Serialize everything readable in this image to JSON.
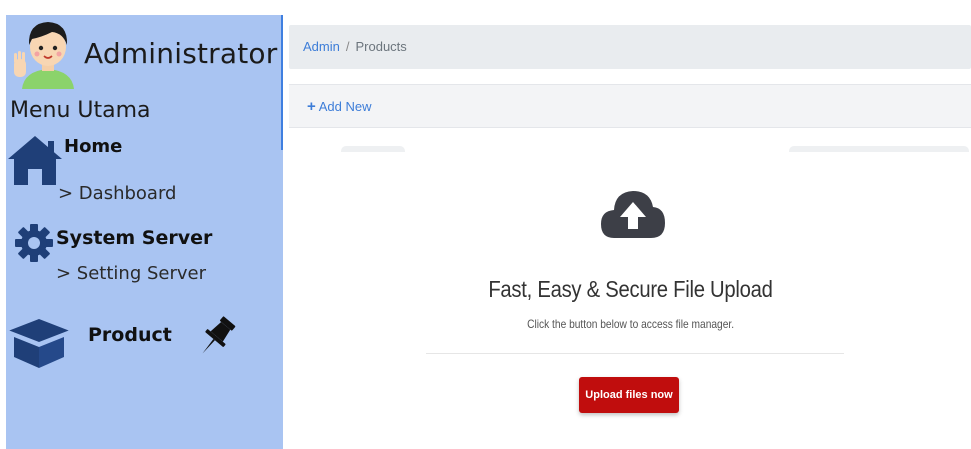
{
  "sidebar": {
    "title": "Administrator",
    "menu_heading": "Menu Utama",
    "home": {
      "label": "Home",
      "icon": "home-icon"
    },
    "dashboard_link": "> Dashboard",
    "system_server": {
      "label": "System Server",
      "icon": "gear-icon"
    },
    "setting_server_link": "> Setting Server",
    "product": {
      "label": "Product",
      "icon": "box-icon",
      "pin_icon": "pin-icon"
    },
    "colors": {
      "background": "#a9c4f2",
      "accent": "#3f7fe0"
    }
  },
  "breadcrumb": {
    "root": "Admin",
    "separator": "/",
    "current": "Products"
  },
  "toolbar": {
    "add_new_plus": "+",
    "add_new_label": "Add New"
  },
  "upload": {
    "icon": "cloud-upload-icon",
    "title": "Fast, Easy & Secure File Upload",
    "subtitle": "Click the button below to access file manager.",
    "button_label": "Upload files now",
    "button_color": "#c00d0d"
  }
}
